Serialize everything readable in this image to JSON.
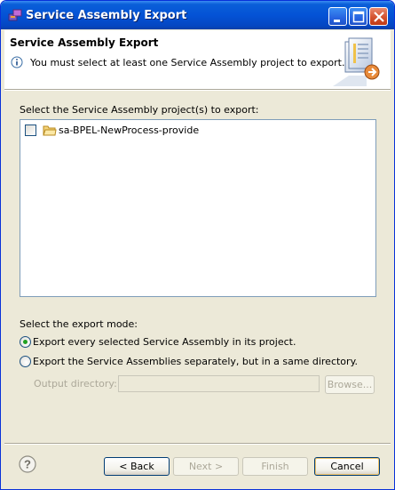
{
  "window": {
    "title": "Service Assembly Export"
  },
  "header": {
    "title": "Service Assembly Export",
    "message": "You must select at least one Service Assembly project to export."
  },
  "projects": {
    "label": "Select the Service Assembly project(s) to export:",
    "items": [
      {
        "name": "sa-BPEL-NewProcess-provide",
        "checked": false
      }
    ]
  },
  "export_mode": {
    "label": "Select the export mode:",
    "options": [
      {
        "label": "Export every selected Service Assembly in its project.",
        "selected": true
      },
      {
        "label": "Export the Service Assemblies separately, but in a same directory.",
        "selected": false
      }
    ],
    "output_dir_label": "Output directory:",
    "output_dir_value": "",
    "browse_label": "Browse..."
  },
  "buttons": {
    "back": "< Back",
    "next": "Next >",
    "finish": "Finish",
    "cancel": "Cancel"
  },
  "icons": {
    "title": "eclipse-app-icon",
    "info": "info-icon",
    "wizard": "export-wizard-icon",
    "folder": "project-folder-icon",
    "help": "help-icon"
  },
  "colors": {
    "titlebar": "#0453d6",
    "dialog_bg": "#ece9d8",
    "radio_selected": "#21a121"
  }
}
